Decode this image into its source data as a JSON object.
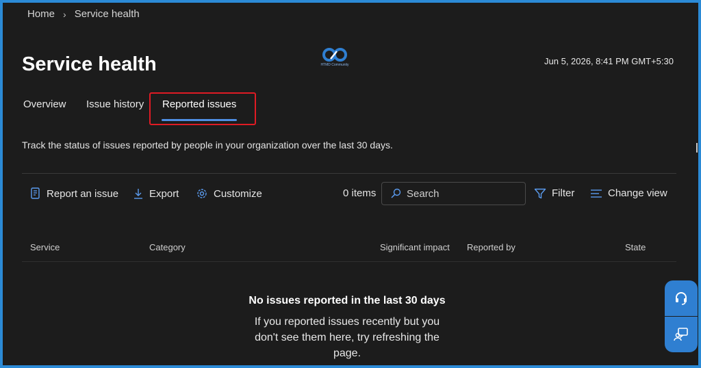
{
  "breadcrumb": {
    "home": "Home",
    "current": "Service health"
  },
  "logo": {
    "icon": "brand-logo-icon",
    "text": "HTMD Community"
  },
  "page": {
    "title": "Service health",
    "timestamp": "Jun 5, 2026, 8:41 PM GMT+5:30",
    "description": "Track the status of issues reported by people in your organization over the last 30 days."
  },
  "tabs": [
    {
      "label": "Overview",
      "active": false
    },
    {
      "label": "Issue history",
      "active": false
    },
    {
      "label": "Reported issues",
      "active": true
    }
  ],
  "toolbar": {
    "report_label": "Report an issue",
    "export_label": "Export",
    "customize_label": "Customize",
    "items_count": "0 items",
    "search_placeholder": "Search",
    "filter_label": "Filter",
    "change_view_label": "Change view"
  },
  "table": {
    "columns": [
      "Service",
      "Category",
      "Significant impact",
      "Reported by",
      "State"
    ],
    "rows": []
  },
  "empty_state": {
    "title": "No issues reported in the last 30 days",
    "body": "If you reported issues recently but you don't see them here, try refreshing the page."
  },
  "side_buttons": [
    {
      "icon": "headset-icon"
    },
    {
      "icon": "feedback-icon"
    }
  ],
  "colors": {
    "accent": "#4f8fe6",
    "highlight": "#e01b24",
    "background": "#1c1c1c",
    "frame": "#2b8ad6"
  }
}
